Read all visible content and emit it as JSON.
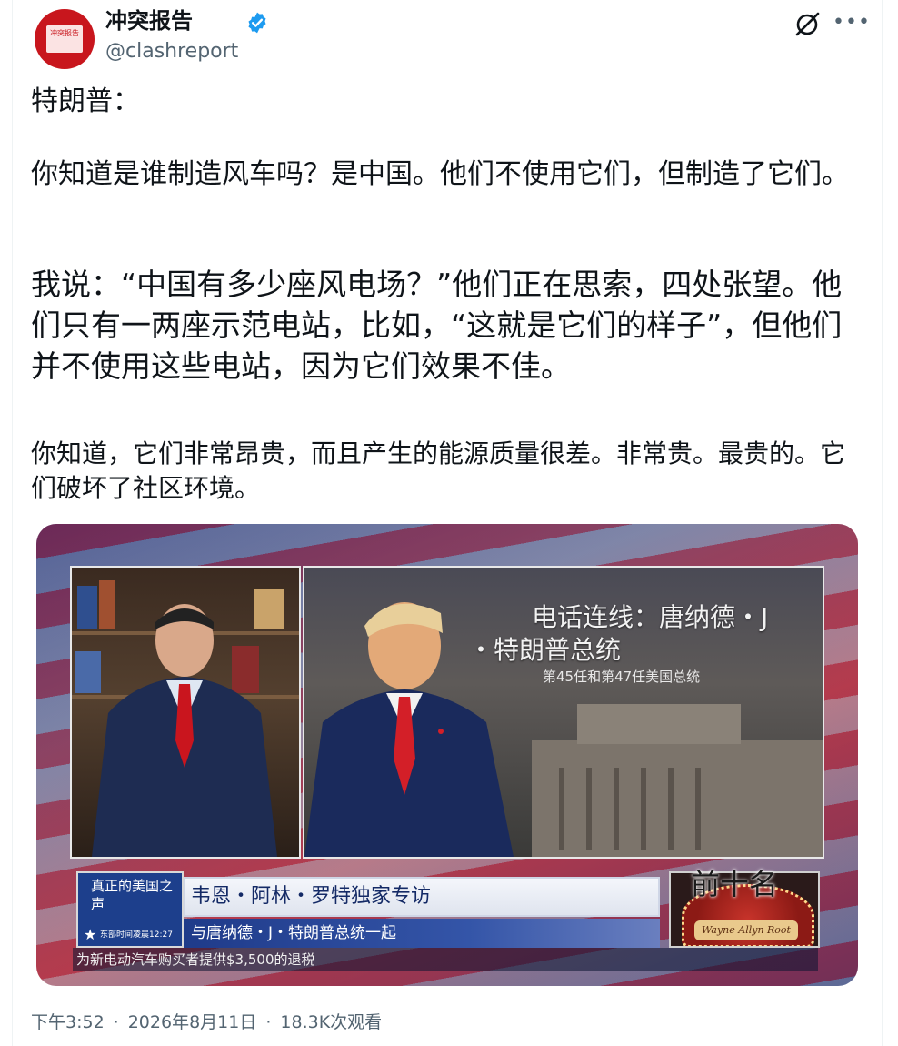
{
  "account": {
    "display_name": "冲突报告",
    "handle": "@clashreport",
    "avatar_text": "冲突报告"
  },
  "post": {
    "line1": "特朗普：",
    "line2": "你知道是谁制造风车吗？是中国。他们不使用它们，但制造了它们。",
    "line3": "我说：“中国有多少座风电场？”他们正在思索，四处张望。他们只有一两座示范电站，比如，“这就是它们的样子”，但他们并不使用这些电站，因为它们效果不佳。",
    "line4": "你知道，它们非常昂贵，而且产生的能源质量很差。非常贵。最贵的。它们破坏了社区环境。"
  },
  "video": {
    "overlay_title_1": "电话连线：唐纳德・J",
    "overlay_title_2": "・特朗普总统",
    "overlay_subtitle": "第45任和第47任美国总统",
    "badge_title": "真正的美国之声",
    "badge_time": "东部时间凌晨12:27",
    "headline": "韦恩・阿林・罗特独家专访",
    "subheadline": "与唐纳德・J・特朗普总统一起",
    "ticker": "为新电动汽车购买者提供$3,500的退税",
    "logo_text": "Wayne Allyn Root",
    "corner_label": "前十名"
  },
  "meta": {
    "time": "下午3:52",
    "date": "2026年8月11日",
    "views": "18.3K次观看"
  },
  "colors": {
    "text": "#0f1419",
    "secondary": "#536471",
    "verified": "#1d9bf0",
    "avatar_red": "#c8161d"
  },
  "icons": [
    "verified-badge-icon",
    "grok-icon",
    "more-icon",
    "star-icon"
  ]
}
